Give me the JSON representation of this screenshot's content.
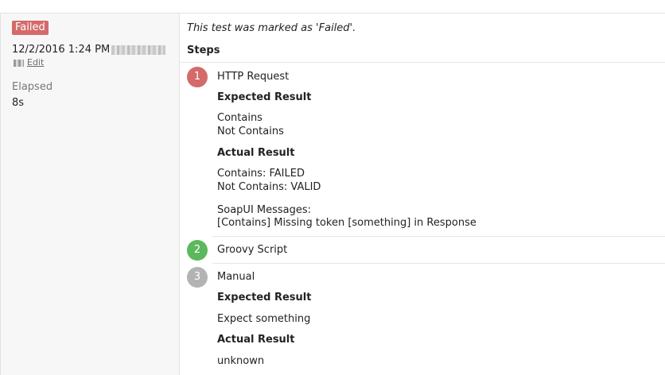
{
  "left_panel": {
    "status_badge": "Failed",
    "timestamp": "12/2/2016 1:24 PM",
    "edit_label": "Edit",
    "elapsed_label": "Elapsed",
    "elapsed_value": "8s"
  },
  "main": {
    "status_message": "This test was marked as 'Failed'.",
    "steps_heading": "Steps",
    "steps": [
      {
        "number": "1",
        "title": "HTTP Request",
        "expected_heading": "Expected Result",
        "expected_lines": [
          "Contains",
          "Not Contains"
        ],
        "actual_heading": "Actual Result",
        "actual_lines": [
          "Contains: FAILED",
          "Not Contains: VALID"
        ],
        "messages_lines": [
          "SoapUI Messages:",
          "[Contains] Missing token [something] in Response"
        ]
      },
      {
        "number": "2",
        "title": "Groovy Script"
      },
      {
        "number": "3",
        "title": "Manual",
        "expected_heading": "Expected Result",
        "expected_lines": [
          "Expect something"
        ],
        "actual_heading": "Actual Result",
        "actual_lines": [
          "unknown"
        ]
      }
    ]
  },
  "colors": {
    "failed": "#d46a6a",
    "passed": "#5cb85c",
    "untested": "#b3b3b3"
  }
}
